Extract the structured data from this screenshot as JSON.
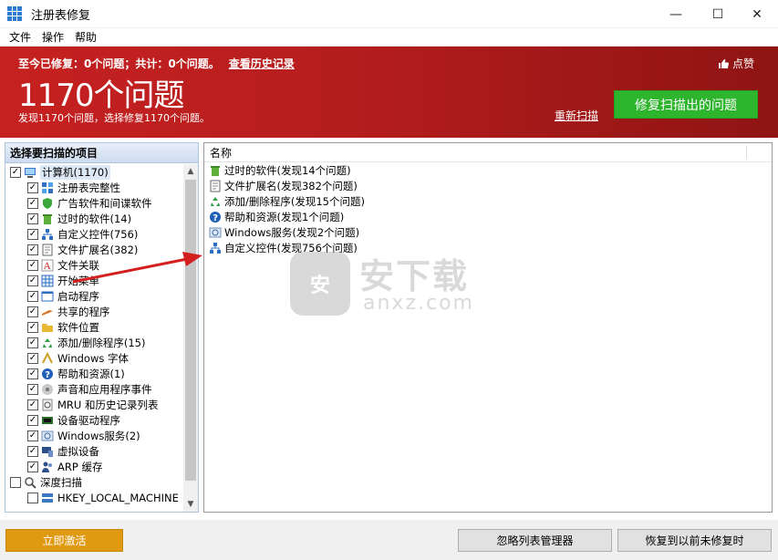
{
  "window": {
    "title": "注册表修复"
  },
  "menu": [
    "文件",
    "操作",
    "帮助"
  ],
  "banner": {
    "summary": "至今已修复：0个问题；共计：0个问题。",
    "history_link": "查看历史记录",
    "like": "点赞",
    "headline": "1170个问题",
    "subline": "发现1170个问题，选择修复1170个问题。",
    "rescan": "重新扫描",
    "fix_button": "修复扫描出的问题",
    "colors": {
      "banner": "#c62121",
      "fix_button": "#2db52d"
    }
  },
  "left_panel": {
    "header": "选择要扫描的项目",
    "items": [
      {
        "label": "计算机(1170)",
        "checked": true,
        "level": 0,
        "icon": "computer-icon"
      },
      {
        "label": "注册表完整性",
        "checked": true,
        "level": 1,
        "icon": "registry-blocks-icon"
      },
      {
        "label": "广告软件和间谍软件",
        "checked": true,
        "level": 1,
        "icon": "shield-icon"
      },
      {
        "label": "过时的软件(14)",
        "checked": true,
        "level": 1,
        "icon": "trash-icon"
      },
      {
        "label": "自定义控件(756)",
        "checked": true,
        "level": 1,
        "icon": "network-icon"
      },
      {
        "label": "文件扩展名(382)",
        "checked": true,
        "level": 1,
        "icon": "file-icon"
      },
      {
        "label": "文件关联",
        "checked": true,
        "level": 1,
        "icon": "font-a-icon"
      },
      {
        "label": "开始菜单",
        "checked": true,
        "level": 1,
        "icon": "grid-icon"
      },
      {
        "label": "启动程序",
        "checked": true,
        "level": 1,
        "icon": "window-icon"
      },
      {
        "label": "共享的程序",
        "checked": true,
        "level": 1,
        "icon": "tool-icon"
      },
      {
        "label": "软件位置",
        "checked": true,
        "level": 1,
        "icon": "folder-icon"
      },
      {
        "label": "添加/删除程序(15)",
        "checked": true,
        "level": 1,
        "icon": "recycle-icon"
      },
      {
        "label": "Windows 字体",
        "checked": true,
        "level": 1,
        "icon": "font-icon"
      },
      {
        "label": "帮助和资源(1)",
        "checked": true,
        "level": 1,
        "icon": "help-icon"
      },
      {
        "label": "声音和应用程序事件",
        "checked": true,
        "level": 1,
        "icon": "sound-icon"
      },
      {
        "label": "MRU 和历史记录列表",
        "checked": true,
        "level": 1,
        "icon": "history-icon"
      },
      {
        "label": "设备驱动程序",
        "checked": true,
        "level": 1,
        "icon": "chip-icon"
      },
      {
        "label": "Windows服务(2)",
        "checked": true,
        "level": 1,
        "icon": "service-icon"
      },
      {
        "label": "虚拟设备",
        "checked": true,
        "level": 1,
        "icon": "monitor-icon"
      },
      {
        "label": "ARP 缓存",
        "checked": true,
        "level": 1,
        "icon": "people-icon"
      },
      {
        "label": "深度扫描",
        "checked": false,
        "level": 0,
        "icon": "magnifier-icon"
      },
      {
        "label": "HKEY_LOCAL_MACHINE",
        "checked": false,
        "level": 1,
        "icon": "server-icon"
      }
    ]
  },
  "right_panel": {
    "column": "名称",
    "items": [
      {
        "label": "过时的软件(发现14个问题)",
        "icon": "trash-icon"
      },
      {
        "label": "文件扩展名(发现382个问题)",
        "icon": "file-icon"
      },
      {
        "label": "添加/删除程序(发现15个问题)",
        "icon": "recycle-icon"
      },
      {
        "label": "帮助和资源(发现1个问题)",
        "icon": "help-icon"
      },
      {
        "label": "Windows服务(发现2个问题)",
        "icon": "service-icon"
      },
      {
        "label": "自定义控件(发现756个问题)",
        "icon": "network-icon"
      }
    ]
  },
  "watermark": {
    "big": "安下载",
    "small": "anxz.com",
    "badge": "安"
  },
  "bottom": {
    "activate": "立即激活",
    "ignore_list": "忽略列表管理器",
    "restore": "恢复到以前未修复时"
  }
}
